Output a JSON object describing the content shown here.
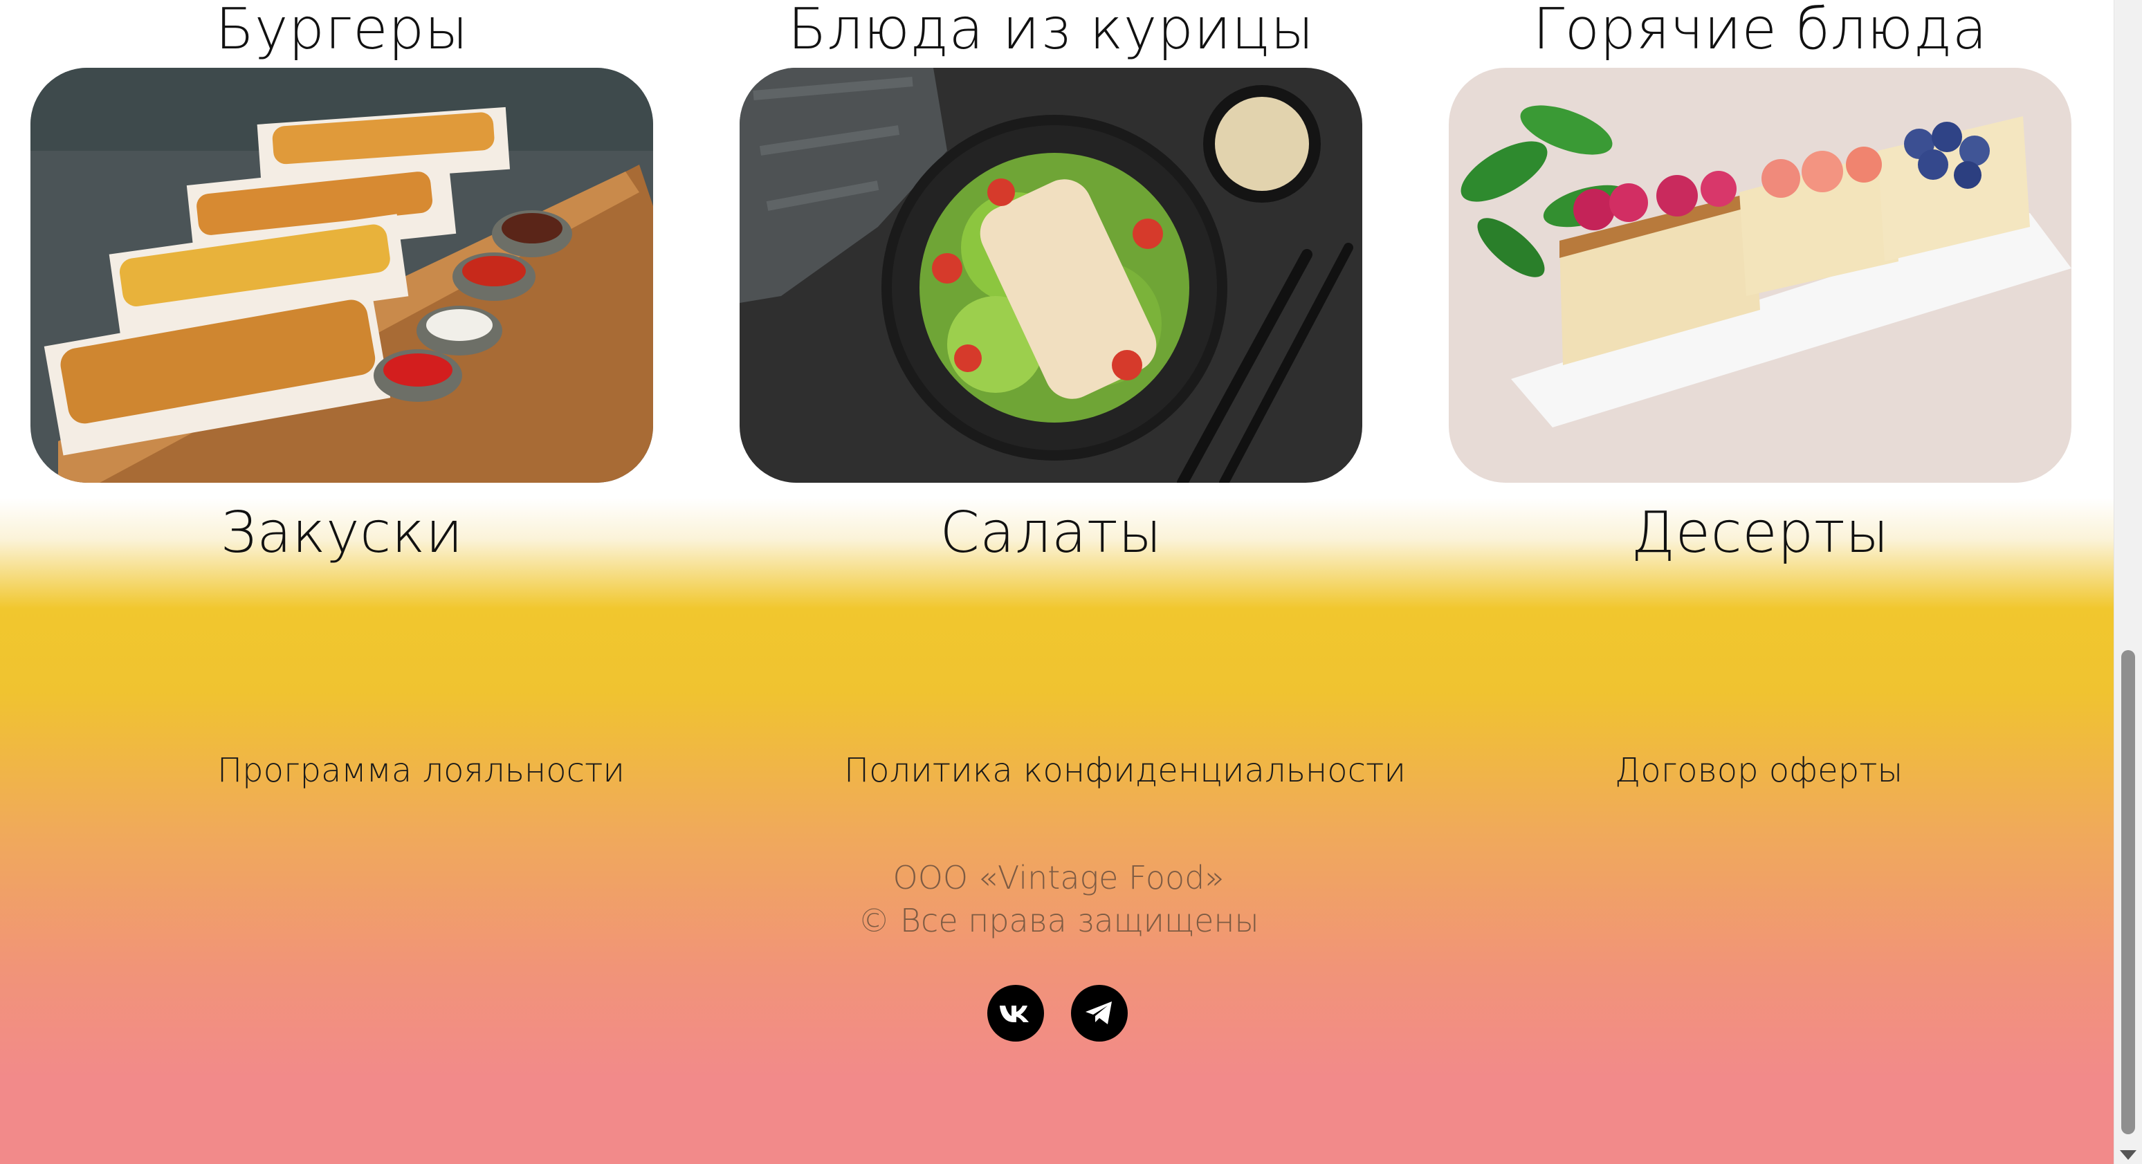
{
  "categories": {
    "top": [
      "Бургеры",
      "Блюда из курицы",
      "Горячие блюда"
    ],
    "bottom": [
      "Закуски",
      "Салаты",
      "Десерты"
    ]
  },
  "footer": {
    "links": [
      "Программа лояльности",
      "Политика конфиденциальности",
      "Договор оферты"
    ],
    "company": "ООО «Vintage Food»",
    "rights": "© Все права защищены"
  },
  "social": [
    "vk-icon",
    "telegram-icon"
  ],
  "colors": {
    "gradient_yellow": "#f1c72e",
    "gradient_orange": "#f0aa5a",
    "gradient_pink": "#f28a8a",
    "copy_text": "#7d5b43"
  }
}
